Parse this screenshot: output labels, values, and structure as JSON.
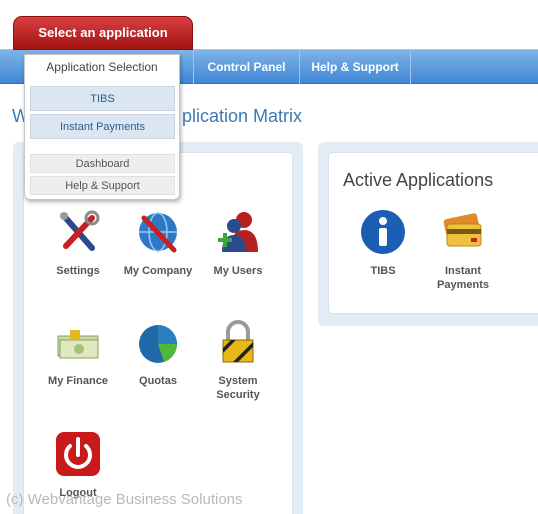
{
  "select_button": "Select an application",
  "nav": {
    "control_panel": "Control Panel",
    "help_support": "Help & Support"
  },
  "page_title_visible": "plication Matrix",
  "page_title_prefix": "W",
  "dropdown": {
    "header": "Application Selection",
    "apps": [
      "TIBS",
      "Instant Payments"
    ],
    "links": [
      "Dashboard",
      "Help & Support"
    ]
  },
  "tools": [
    {
      "label": "Settings",
      "icon": "settings-icon"
    },
    {
      "label": "My Company",
      "icon": "company-globe-icon"
    },
    {
      "label": "My Users",
      "icon": "users-icon"
    },
    {
      "label": "My Finance",
      "icon": "money-icon"
    },
    {
      "label": "Quotas",
      "icon": "pie-chart-icon"
    },
    {
      "label": "System Security",
      "icon": "padlock-icon"
    },
    {
      "label": "Logout",
      "icon": "power-icon"
    }
  ],
  "active_apps": {
    "title": "Active Applications",
    "items": [
      {
        "label": "TIBS",
        "icon": "info-icon"
      },
      {
        "label": "Instant Payments",
        "icon": "credit-card-icon"
      }
    ]
  },
  "copyright": "(c) Webvantage Business Solutions",
  "colors": {
    "nav_blue": "#3f86d4",
    "button_red": "#a51313",
    "title_blue": "#3f78b5"
  }
}
